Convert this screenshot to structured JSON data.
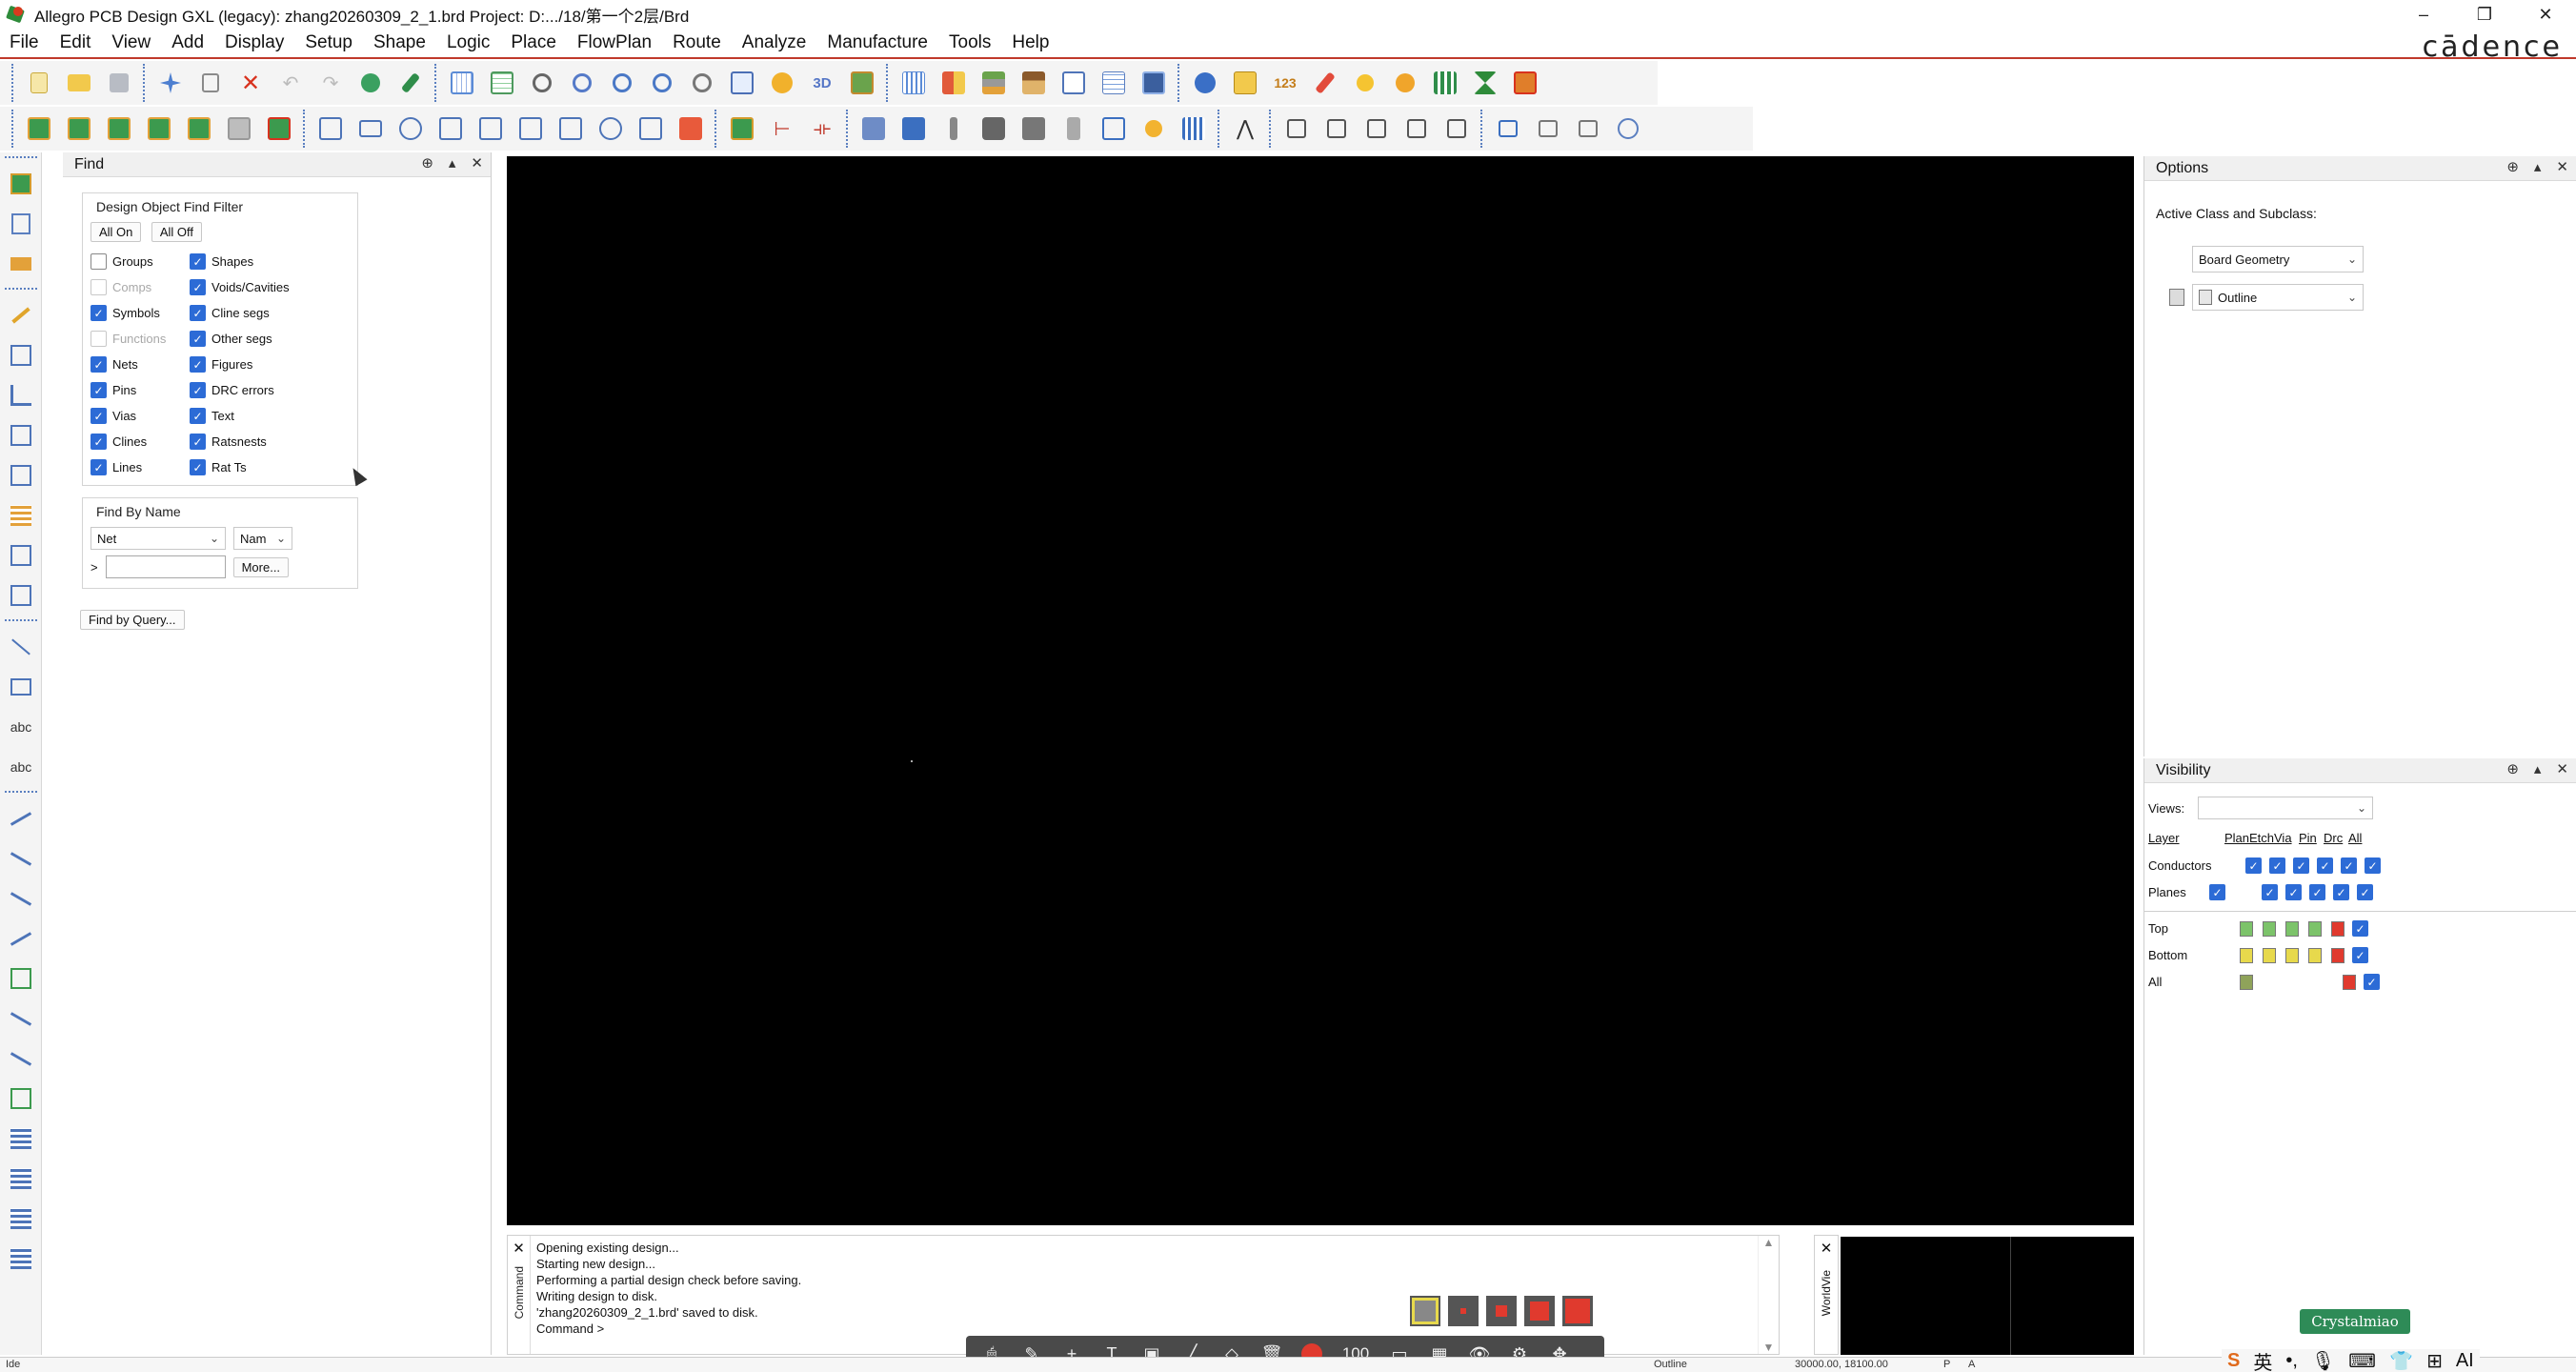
{
  "window": {
    "title": "Allegro PCB Design GXL (legacy): zhang20260309_2_1.brd  Project: D:.../18/第一个2层/Brd",
    "controls": [
      "–",
      "❐",
      "✕"
    ]
  },
  "brand": {
    "logo_text": "cādence"
  },
  "menu": {
    "items": [
      "File",
      "Edit",
      "View",
      "Add",
      "Display",
      "Setup",
      "Shape",
      "Logic",
      "Place",
      "FlowPlan",
      "Route",
      "Analyze",
      "Manufacture",
      "Tools",
      "Help"
    ]
  },
  "find": {
    "panel_title": "Find",
    "group_title": "Design Object Find Filter",
    "all_on_label": "All On",
    "all_off_label": "All Off",
    "filters_left": [
      {
        "label": "Groups",
        "checked": false,
        "enabled": true
      },
      {
        "label": "Comps",
        "checked": false,
        "enabled": false
      },
      {
        "label": "Symbols",
        "checked": true,
        "enabled": true
      },
      {
        "label": "Functions",
        "checked": false,
        "enabled": false
      },
      {
        "label": "Nets",
        "checked": true,
        "enabled": true
      },
      {
        "label": "Pins",
        "checked": true,
        "enabled": true
      },
      {
        "label": "Vias",
        "checked": true,
        "enabled": true
      },
      {
        "label": "Clines",
        "checked": true,
        "enabled": true
      },
      {
        "label": "Lines",
        "checked": true,
        "enabled": true
      }
    ],
    "filters_right": [
      {
        "label": "Shapes",
        "checked": true
      },
      {
        "label": "Voids/Cavities",
        "checked": true
      },
      {
        "label": "Cline segs",
        "checked": true
      },
      {
        "label": "Other segs",
        "checked": true
      },
      {
        "label": "Figures",
        "checked": true
      },
      {
        "label": "DRC errors",
        "checked": true
      },
      {
        "label": "Text",
        "checked": true
      },
      {
        "label": "Ratsnests",
        "checked": true
      },
      {
        "label": "Rat Ts",
        "checked": true
      }
    ],
    "by_name_title": "Find By Name",
    "type_select": "Net",
    "mode_select": "Nam",
    "prompt": ">",
    "name_value": "",
    "more_label": "More...",
    "query_label": "Find by Query..."
  },
  "console": {
    "side_label": "Command",
    "lines": [
      "Opening existing design...",
      "Starting new design...",
      "Performing a partial design check before saving.",
      "Writing design to disk.",
      "'zhang20260309_2_1.brd' saved to disk.",
      "Command >"
    ]
  },
  "worldview": {
    "side_label": "WorldVie"
  },
  "options": {
    "panel_title": "Options",
    "active_class_label": "Active Class and Subclass:",
    "class_value": "Board Geometry",
    "subclass_value": "Outline"
  },
  "visibility": {
    "panel_title": "Visibility",
    "views_label": "Views:",
    "views_value": "",
    "headers": [
      "Layer",
      "Plan",
      "Etch",
      "Via",
      "Pin",
      "Drc",
      "All"
    ],
    "rows": [
      {
        "name": "Conductors"
      },
      {
        "name": "Planes"
      },
      {
        "name": "Top"
      },
      {
        "name": "Bottom"
      },
      {
        "name": "All"
      }
    ]
  },
  "bottom_toolbar": {
    "zoom_value": "100"
  },
  "status": {
    "left": "Ide",
    "subclass": "Outline",
    "coords": "30000.00, 18100.00",
    "p_flag": "P",
    "a_flag": "A"
  },
  "tray": {
    "badge_text": "Crystalmiao",
    "items": [
      "S",
      "英",
      "•,",
      "🎙",
      "⌨",
      "👕",
      "⊞",
      "AI"
    ]
  },
  "colors": {
    "accent_blue": "#2c6bd6",
    "menu_underline": "#c0392b",
    "canvas_bg": "#000000",
    "drc_red": "#e03a2e",
    "swatch_yellow": "#e7d94c",
    "swatch_green": "#7cc36a"
  }
}
